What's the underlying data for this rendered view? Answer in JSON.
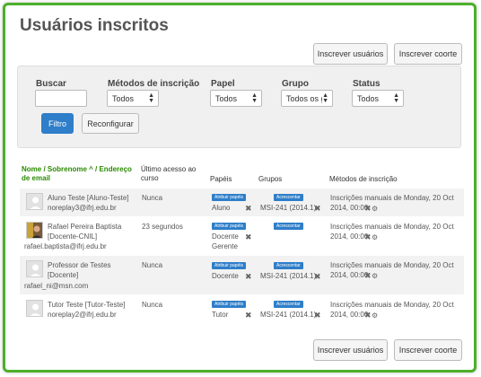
{
  "page": {
    "title": "Usuários inscritos"
  },
  "toolbar": {
    "enrol_users": "Inscrever usuários",
    "enrol_cohort": "Inscrever coorte"
  },
  "filter": {
    "search_label": "Buscar",
    "search_value": "",
    "method_label": "Métodos de inscrição",
    "method_value": "Todos",
    "role_label": "Papel",
    "role_value": "Todos",
    "group_label": "Grupo",
    "group_value": "Todos os g",
    "status_label": "Status",
    "status_value": "Todos",
    "filter_button": "Filtro",
    "reset_button": "Reconfigurar"
  },
  "table": {
    "headers": {
      "name_line1": "Nome / Sobrenome ",
      "sort_arrow": "^",
      "name_line1b": " / Endereço",
      "name_line2": "de email",
      "last_access_line1": "Último acesso ao",
      "last_access_line2": "curso",
      "roles": "Papéis",
      "groups": "Grupos",
      "methods": "Métodos de inscrição"
    },
    "assign_roles_label": "Atribuir papéis",
    "add_group_label": "Acrescentar",
    "rows": [
      {
        "name": "Aluno Teste [Aluno-Teste]",
        "email": "noreplay3@ifrj.edu.br",
        "last_access": "Nunca",
        "role": "Aluno",
        "group": "MSI-241 (2014.1)",
        "method_line1": "Inscrições manuais de Monday, 20 Oct",
        "method_line2": "2014, 00:00"
      },
      {
        "name": "Rafael Pereira Baptista",
        "name_line2": "[Docente-CNIL]",
        "email": "rafael.baptista@ifrj.edu.br",
        "last_access": "23 segundos",
        "role": "Docente",
        "role2": "Gerente",
        "group": "",
        "method_line1": "Inscrições manuais de Monday, 20 Oct",
        "method_line2": "2014, 00:00"
      },
      {
        "name": "Professor de Testes",
        "name_line2": "[Docente]",
        "email": "rafael_ni@msn.com",
        "last_access": "Nunca",
        "role": "Docente",
        "group": "MSI-241 (2014.1)",
        "method_line1": "Inscrições manuais de Monday, 20 Oct",
        "method_line2": "2014, 00:00"
      },
      {
        "name": "Tutor Teste [Tutor-Teste]",
        "email": "noreplay2@ifrj.edu.br",
        "last_access": "Nunca",
        "role": "Tutor",
        "group": "MSI-241 (2014.1)",
        "method_line1": "Inscrições manuais de Monday, 20 Oct",
        "method_line2": "2014, 00:00"
      }
    ]
  },
  "icons": {
    "remove": "close-icon",
    "settings": "gear-icon",
    "select": "select-arrows-icon"
  },
  "colors": {
    "frame_border": "#4caf2a",
    "primary": "#2e7ec9",
    "sort_header": "#2a8a00",
    "row_alt": "#f2f2f2"
  }
}
